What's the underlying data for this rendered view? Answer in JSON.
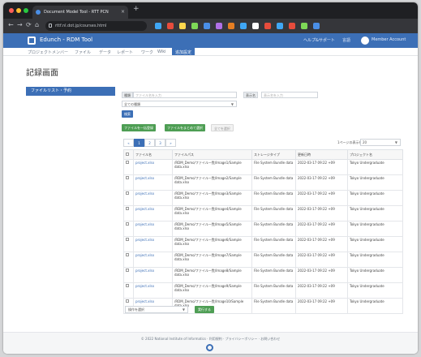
{
  "browser": {
    "tab_title": "Document Model Tool - RTT PCN",
    "new_tab": "+",
    "url": "rttf.nl.dot.jp/courses.html",
    "nav": {
      "back": "←",
      "forward": "→",
      "reload": "⟳",
      "home": "⌂"
    },
    "extension_colors": [
      "#3fa7f5",
      "#e74c3c",
      "#ffd84d",
      "#7ed957",
      "#4a8fe7",
      "#b070e6",
      "#e67e22",
      "#3fa7f5",
      "#ffffff",
      "#e74c3c",
      "#3fa7f5",
      "#e74c3c",
      "#7ed957",
      "#4a8fe7"
    ]
  },
  "header": {
    "brand": "Edunch - RDM Tool",
    "links": [
      "ヘルプ&サポート",
      "言語"
    ],
    "user": "Member Account"
  },
  "nav": {
    "items": [
      "プロジェクトメンバー",
      "ファイル",
      "データ",
      "レポート",
      "ワーク",
      "Wiki",
      "追加設定"
    ]
  },
  "page": {
    "title": "記録画面"
  },
  "sidebar": {
    "active_item": "ファイルリスト・予約"
  },
  "filters": {
    "label1": "種類",
    "input1_placeholder": "ファイル名を入力",
    "label2": "表示名",
    "input2_placeholder": "表示名を入力",
    "select_value": "全ての種類",
    "search_button": "検索"
  },
  "actions": {
    "btn1": "ファイルを一括登録",
    "btn2": "ファイルをまとめて選択",
    "btn3": "全てを選択"
  },
  "pagination": {
    "pages": [
      "«",
      "1",
      "2",
      "3",
      "»"
    ],
    "active": "1"
  },
  "per_page": {
    "label": "1ページの表示件数",
    "value": "20"
  },
  "table": {
    "headers": [
      "ファイル名",
      "ファイルパス",
      "ストレージタイプ",
      "更新日時",
      "プロジェクト名"
    ],
    "rows": [
      [
        "project.xlsx",
        "/RDM_Demo/ファイル一覧/Image1/Sample data.xlsx",
        "File System Bundle data",
        "2022-03-17 09:22 +09",
        "Tokyo Undergraduate"
      ],
      [
        "project.xlsx",
        "/RDM_Demo/ファイル一覧/Image2/Sample data.xlsx",
        "File System Bundle data",
        "2022-03-17 09:22 +09",
        "Tokyo Undergraduate"
      ],
      [
        "project.xlsx",
        "/RDM_Demo/ファイル一覧/Image3/Sample data.xlsx",
        "File System Bundle data",
        "2022-03-17 09:22 +09",
        "Tokyo Undergraduate"
      ],
      [
        "project.xlsx",
        "/RDM_Demo/ファイル一覧/Image4/Sample data.xlsx",
        "File System Bundle data",
        "2022-03-17 09:22 +09",
        "Tokyo Undergraduate"
      ],
      [
        "project.xlsx",
        "/RDM_Demo/ファイル一覧/Image5/Sample data.xlsx",
        "File System Bundle data",
        "2022-03-17 09:22 +09",
        "Tokyo Undergraduate"
      ],
      [
        "project.xlsx",
        "/RDM_Demo/ファイル一覧/Image6/Sample data.xlsx",
        "File System Bundle data",
        "2022-03-17 09:22 +09",
        "Tokyo Undergraduate"
      ],
      [
        "project.xlsx",
        "/RDM_Demo/ファイル一覧/Image7/Sample data.xlsx",
        "File System Bundle data",
        "2022-03-17 09:22 +09",
        "Tokyo Undergraduate"
      ],
      [
        "project.xlsx",
        "/RDM_Demo/ファイル一覧/Image8/Sample data.xlsx",
        "File System Bundle data",
        "2022-03-17 09:22 +09",
        "Tokyo Undergraduate"
      ],
      [
        "project.xlsx",
        "/RDM_Demo/ファイル一覧/Image9/Sample data.xlsx",
        "File System Bundle data",
        "2022-03-17 09:22 +09",
        "Tokyo Undergraduate"
      ],
      [
        "project.xlsx",
        "/RDM_Demo/ファイル一覧/Image10/Sample data.xlsx",
        "File System Bundle data",
        "2022-03-17 09:22 +09",
        "Tokyo Undergraduate"
      ]
    ]
  },
  "bottom": {
    "select_value": "操作を選択",
    "button": "実行する"
  },
  "footer": {
    "text": "© 2022 National Institute of Informatics · 利用規約 · プライバシーポリシー · お問い合わせ"
  },
  "colors": {
    "accent": "#3c6fb6",
    "success": "#4e9e54",
    "chrome_dark": "#1f2023"
  }
}
